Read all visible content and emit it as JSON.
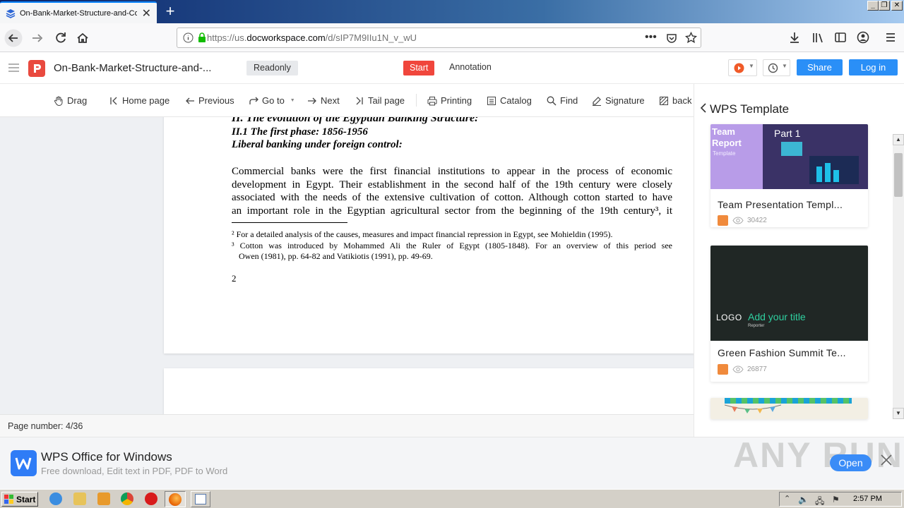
{
  "browser": {
    "tab_title": "On-Bank-Market-Structure-and-Co",
    "url_prefix": "https://us.",
    "url_domain": "docworkspace.com",
    "url_path": "/d/sIP7M9IIu1N_v_wU"
  },
  "app": {
    "doc_title": "On-Bank-Market-Structure-and-...",
    "readonly_label": "Readonly",
    "start_label": "Start",
    "annotation_label": "Annotation",
    "share_label": "Share",
    "login_label": "Log in",
    "accent": "#2a8ff7",
    "brand": "#e94a3f"
  },
  "toolbar": {
    "items": [
      {
        "label": "Drag",
        "icon": "hand-icon"
      },
      {
        "label": "Home page",
        "icon": "first-page-icon"
      },
      {
        "label": "Previous",
        "icon": "arrow-left-icon"
      },
      {
        "label": "Go to",
        "icon": "goto-icon"
      },
      {
        "label": "Next",
        "icon": "arrow-right-icon"
      },
      {
        "label": "Tail page",
        "icon": "last-page-icon"
      },
      {
        "label": "Printing",
        "icon": "printer-icon"
      },
      {
        "label": "Catalog",
        "icon": "catalog-icon"
      },
      {
        "label": "Find",
        "icon": "search-icon"
      },
      {
        "label": "Signature",
        "icon": "pen-icon"
      },
      {
        "label": "back",
        "icon": "background-icon"
      }
    ]
  },
  "document": {
    "heading_cut": "II. The evolution of the Egyptian Banking Structure:",
    "subheading1": "II.1 The first phase: 1856-1956",
    "subheading2": "Liberal banking under foreign control:",
    "para_lines": [
      "Commercial banks were the first financial institutions to appear in the process of economic",
      "development in Egypt. Their establishment in the second half of the 19th century were closely",
      "associated with the needs of the extensive cultivation of cotton. Although cotton started to have",
      "an important role in the Egyptian agricultural sector from the beginning of the 19th century³, it"
    ],
    "footnote2": "² For a detailed analysis of the causes, measures and impact financial repression in Egypt, see Mohieldin (1995).",
    "footnote3_line1": "³ Cotton was introduced by Mohammed Ali the Ruler of Egypt (1805-1848). For an overview of this period see",
    "footnote3_line2": "Owen (1981), pp. 64-82 and Vatikiotis (1991), pp. 49-69.",
    "page_number": "2"
  },
  "status": {
    "page_number": "Page number: 4/36"
  },
  "panel": {
    "title": "WPS Template",
    "cards": [
      {
        "name": "Team Presentation Templ...",
        "views": "30422",
        "thumb_text1": "Team",
        "thumb_text2": "Report",
        "thumb_text3": "Template",
        "thumb_text4": "Part 1"
      },
      {
        "name": "Green Fashion Summit Te...",
        "views": "26877",
        "thumb_logo": "LOGO",
        "thumb_title": "Add your title",
        "thumb_sub": "Reporter"
      }
    ]
  },
  "banner": {
    "title": "WPS Office for Windows",
    "subtitle": "Free download, Edit text in PDF, PDF to Word",
    "open_label": "Open",
    "watermark": "ANY RUN"
  },
  "taskbar": {
    "start_label": "Start",
    "clock": "2:57 PM"
  }
}
